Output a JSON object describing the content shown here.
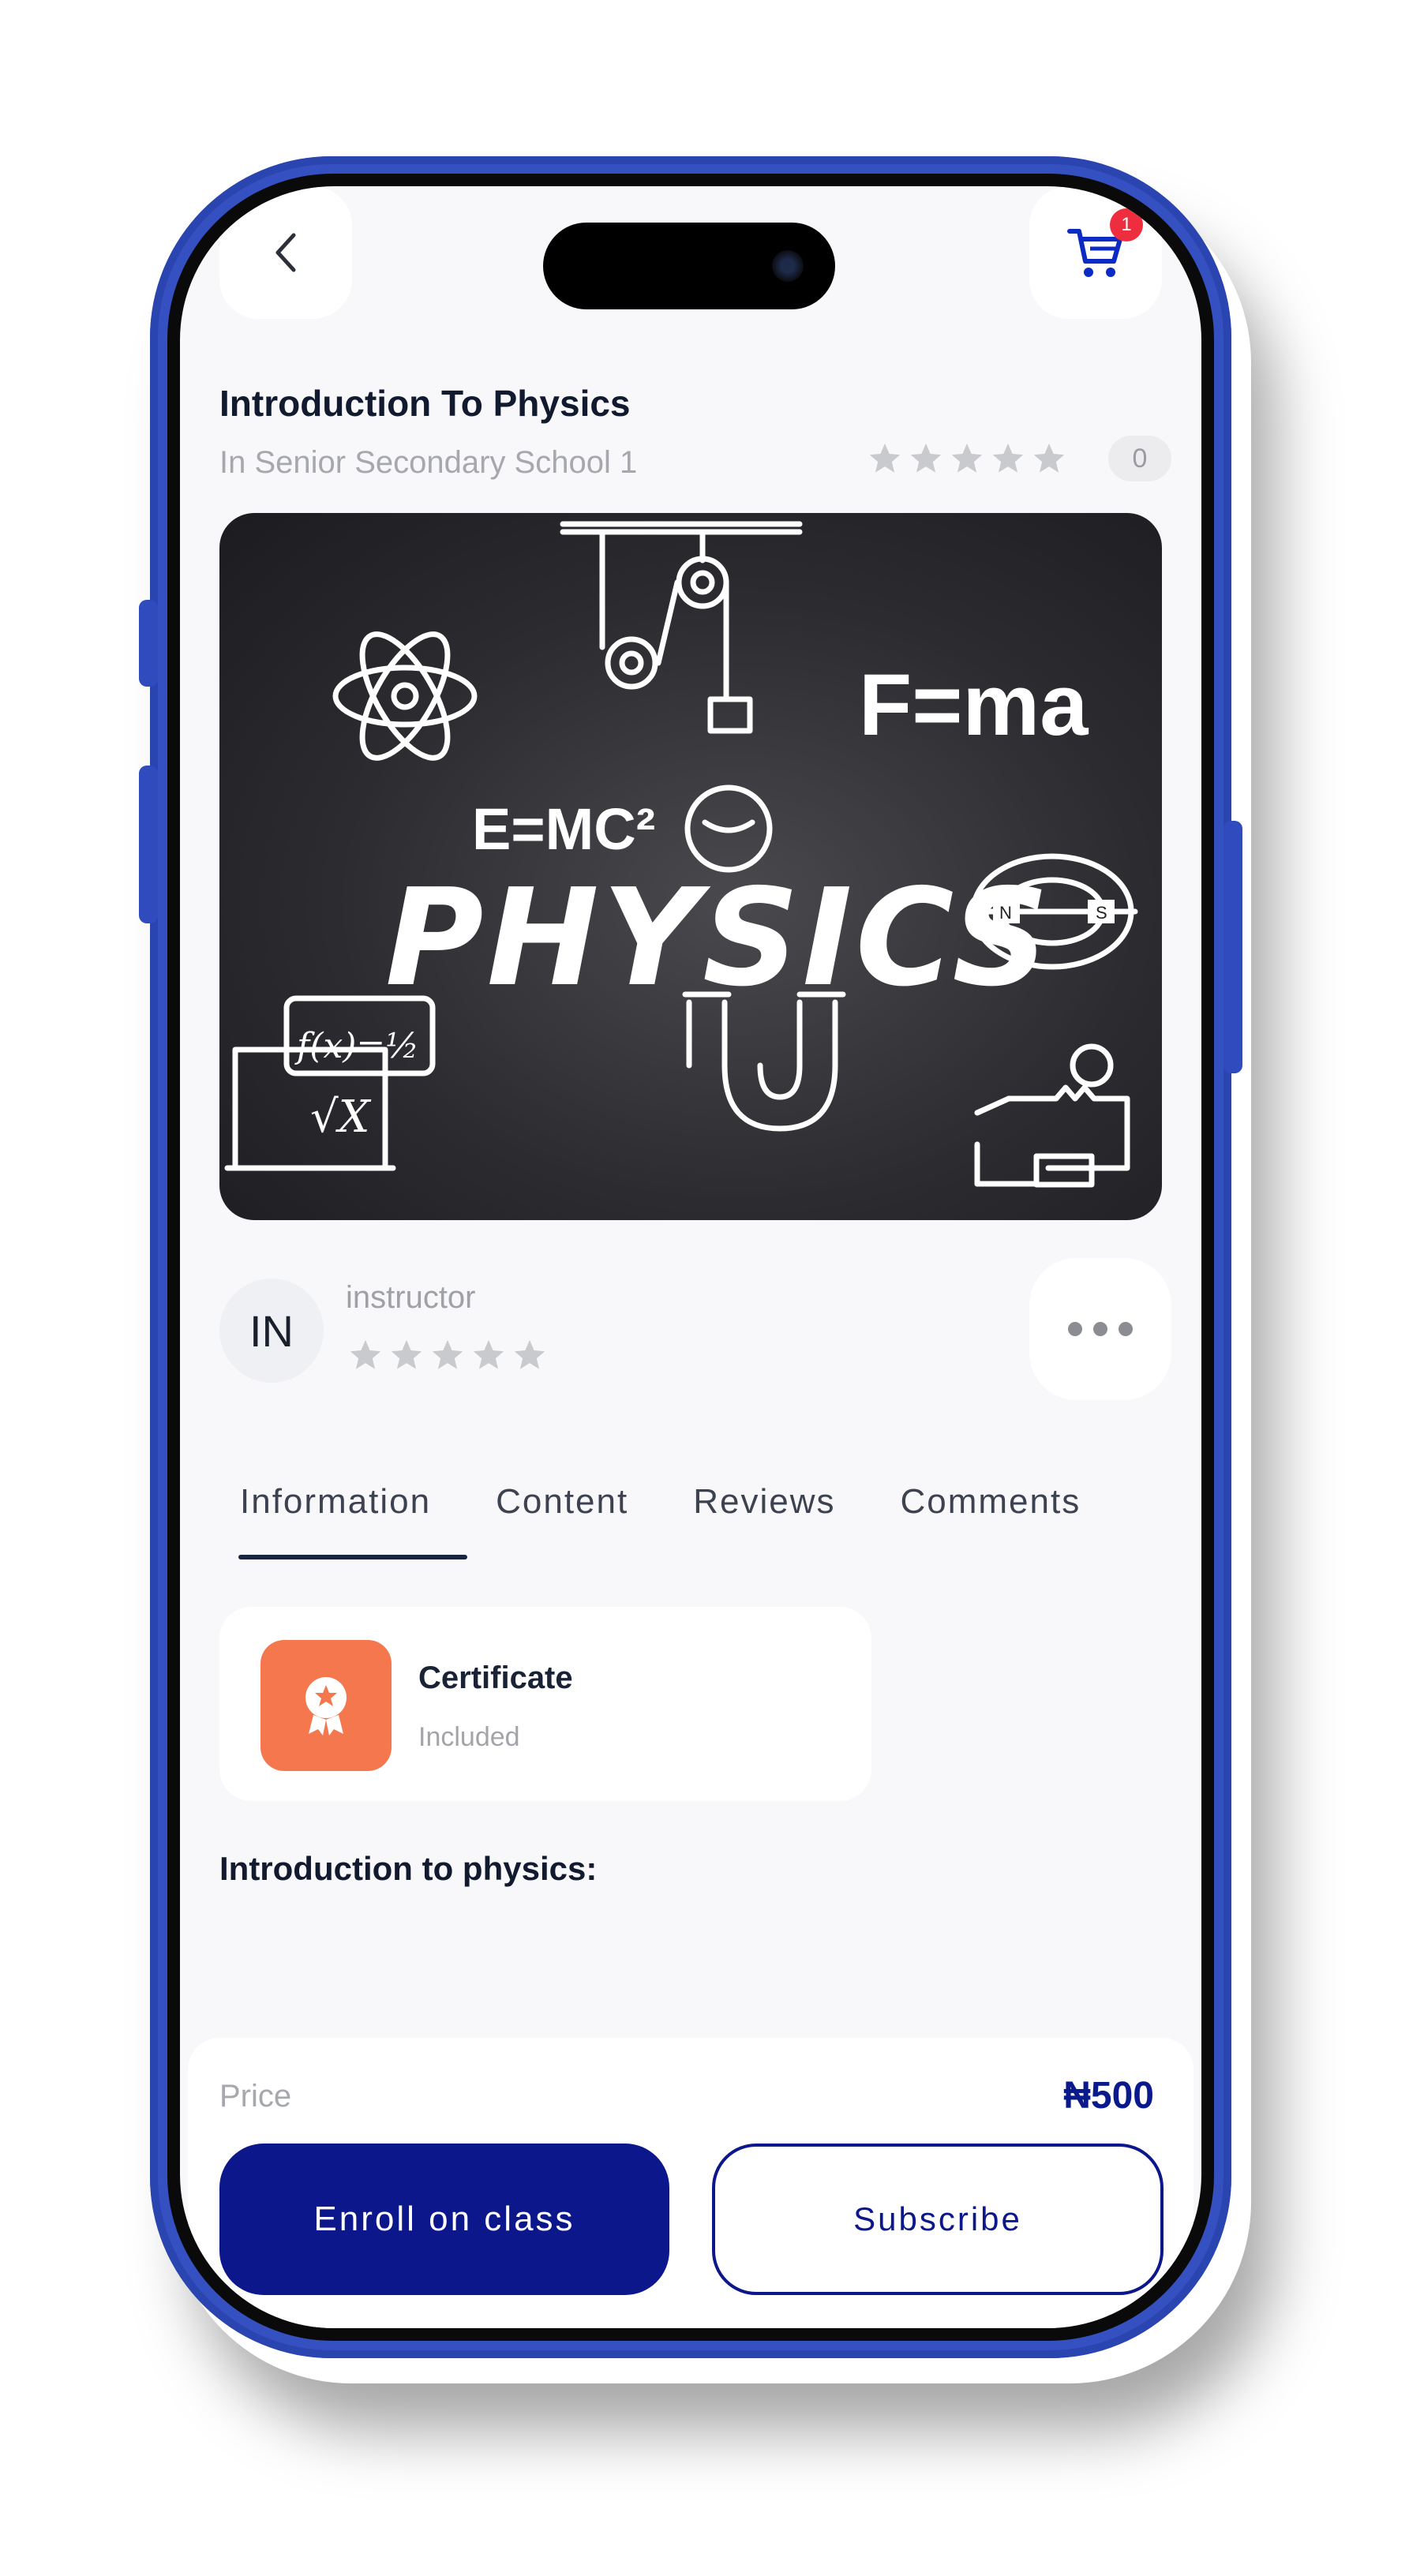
{
  "header": {
    "cart_count": "1"
  },
  "course": {
    "title": "Introduction To Physics",
    "subtitle": "In Senior Secondary School 1",
    "rating": 0,
    "rating_count": "0"
  },
  "hero": {
    "title_text": "PHYSICS",
    "equation_1": "E=MC²",
    "equation_2": "F=ma"
  },
  "instructor": {
    "initials": "IN",
    "name": "instructor",
    "rating": 0
  },
  "tabs": [
    {
      "label": "Information",
      "active": true
    },
    {
      "label": "Content",
      "active": false
    },
    {
      "label": "Reviews",
      "active": false
    },
    {
      "label": "Comments",
      "active": false
    }
  ],
  "certificate": {
    "title": "Certificate",
    "status": "Included"
  },
  "description": {
    "heading": "Introduction to physics:"
  },
  "purchase": {
    "price_label": "Price",
    "price_value": "₦500",
    "enroll_label": "Enroll on class",
    "subscribe_label": "Subscribe"
  },
  "colors": {
    "primary": "#0b178a",
    "frame": "#3550c0",
    "certificate_accent": "#f4774e",
    "badge": "#ee2e3e",
    "star_inactive": "#c9cacd"
  },
  "icons": {
    "back": "chevron-left-icon",
    "cart": "cart-icon",
    "star": "star-icon",
    "more": "more-horizontal-icon",
    "certificate": "award-icon"
  }
}
